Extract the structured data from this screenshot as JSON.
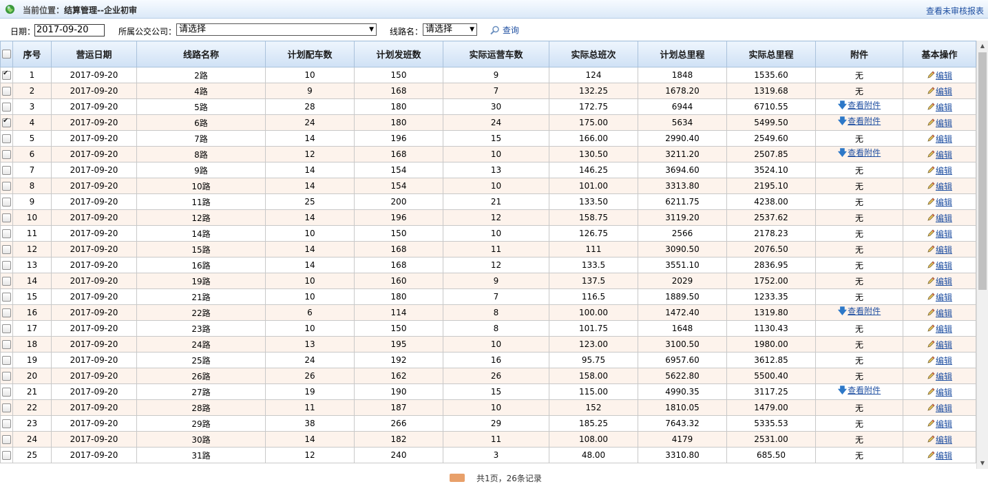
{
  "header": {
    "location_label": "当前位置：",
    "location_path": "结算管理--企业初审",
    "report_link": "查看未审核报表"
  },
  "filters": {
    "date_label": "日期：",
    "date_value": "2017-09-20",
    "company_label": "所属公交公司：",
    "company_value": "请选择",
    "route_label": "线路名：",
    "route_value": "请选择",
    "search_label": "查询"
  },
  "table": {
    "columns": [
      "序号",
      "营运日期",
      "线路名称",
      "计划配车数",
      "计划发班数",
      "实际运营车数",
      "实际总班次",
      "计划总里程",
      "实际总里程",
      "附件",
      "基本操作"
    ],
    "attachment_none": "无",
    "attachment_view": "查看附件",
    "edit_label": "编辑",
    "rows": [
      {
        "no": "1",
        "date": "2017-09-20",
        "route": "2路",
        "plan_cars": "10",
        "plan_shifts": "150",
        "actual_cars": "9",
        "actual_shifts": "124",
        "plan_km": "1848",
        "actual_km": "1535.60",
        "attach": false,
        "checked": true
      },
      {
        "no": "2",
        "date": "2017-09-20",
        "route": "4路",
        "plan_cars": "9",
        "plan_shifts": "168",
        "actual_cars": "7",
        "actual_shifts": "132.25",
        "plan_km": "1678.20",
        "actual_km": "1319.68",
        "attach": false,
        "checked": false
      },
      {
        "no": "3",
        "date": "2017-09-20",
        "route": "5路",
        "plan_cars": "28",
        "plan_shifts": "180",
        "actual_cars": "30",
        "actual_shifts": "172.75",
        "plan_km": "6944",
        "actual_km": "6710.55",
        "attach": true,
        "checked": false
      },
      {
        "no": "4",
        "date": "2017-09-20",
        "route": "6路",
        "plan_cars": "24",
        "plan_shifts": "180",
        "actual_cars": "24",
        "actual_shifts": "175.00",
        "plan_km": "5634",
        "actual_km": "5499.50",
        "attach": true,
        "checked": true
      },
      {
        "no": "5",
        "date": "2017-09-20",
        "route": "7路",
        "plan_cars": "14",
        "plan_shifts": "196",
        "actual_cars": "15",
        "actual_shifts": "166.00",
        "plan_km": "2990.40",
        "actual_km": "2549.60",
        "attach": false,
        "checked": false
      },
      {
        "no": "6",
        "date": "2017-09-20",
        "route": "8路",
        "plan_cars": "12",
        "plan_shifts": "168",
        "actual_cars": "10",
        "actual_shifts": "130.50",
        "plan_km": "3211.20",
        "actual_km": "2507.85",
        "attach": true,
        "checked": false
      },
      {
        "no": "7",
        "date": "2017-09-20",
        "route": "9路",
        "plan_cars": "14",
        "plan_shifts": "154",
        "actual_cars": "13",
        "actual_shifts": "146.25",
        "plan_km": "3694.60",
        "actual_km": "3524.10",
        "attach": false,
        "checked": false
      },
      {
        "no": "8",
        "date": "2017-09-20",
        "route": "10路",
        "plan_cars": "14",
        "plan_shifts": "154",
        "actual_cars": "10",
        "actual_shifts": "101.00",
        "plan_km": "3313.80",
        "actual_km": "2195.10",
        "attach": false,
        "checked": false
      },
      {
        "no": "9",
        "date": "2017-09-20",
        "route": "11路",
        "plan_cars": "25",
        "plan_shifts": "200",
        "actual_cars": "21",
        "actual_shifts": "133.50",
        "plan_km": "6211.75",
        "actual_km": "4238.00",
        "attach": false,
        "checked": false
      },
      {
        "no": "10",
        "date": "2017-09-20",
        "route": "12路",
        "plan_cars": "14",
        "plan_shifts": "196",
        "actual_cars": "12",
        "actual_shifts": "158.75",
        "plan_km": "3119.20",
        "actual_km": "2537.62",
        "attach": false,
        "checked": false
      },
      {
        "no": "11",
        "date": "2017-09-20",
        "route": "14路",
        "plan_cars": "10",
        "plan_shifts": "150",
        "actual_cars": "10",
        "actual_shifts": "126.75",
        "plan_km": "2566",
        "actual_km": "2178.23",
        "attach": false,
        "checked": false
      },
      {
        "no": "12",
        "date": "2017-09-20",
        "route": "15路",
        "plan_cars": "14",
        "plan_shifts": "168",
        "actual_cars": "11",
        "actual_shifts": "111",
        "plan_km": "3090.50",
        "actual_km": "2076.50",
        "attach": false,
        "checked": false
      },
      {
        "no": "13",
        "date": "2017-09-20",
        "route": "16路",
        "plan_cars": "14",
        "plan_shifts": "168",
        "actual_cars": "12",
        "actual_shifts": "133.5",
        "plan_km": "3551.10",
        "actual_km": "2836.95",
        "attach": false,
        "checked": false
      },
      {
        "no": "14",
        "date": "2017-09-20",
        "route": "19路",
        "plan_cars": "10",
        "plan_shifts": "160",
        "actual_cars": "9",
        "actual_shifts": "137.5",
        "plan_km": "2029",
        "actual_km": "1752.00",
        "attach": false,
        "checked": false
      },
      {
        "no": "15",
        "date": "2017-09-20",
        "route": "21路",
        "plan_cars": "10",
        "plan_shifts": "180",
        "actual_cars": "7",
        "actual_shifts": "116.5",
        "plan_km": "1889.50",
        "actual_km": "1233.35",
        "attach": false,
        "checked": false
      },
      {
        "no": "16",
        "date": "2017-09-20",
        "route": "22路",
        "plan_cars": "6",
        "plan_shifts": "114",
        "actual_cars": "8",
        "actual_shifts": "100.00",
        "plan_km": "1472.40",
        "actual_km": "1319.80",
        "attach": true,
        "checked": false
      },
      {
        "no": "17",
        "date": "2017-09-20",
        "route": "23路",
        "plan_cars": "10",
        "plan_shifts": "150",
        "actual_cars": "8",
        "actual_shifts": "101.75",
        "plan_km": "1648",
        "actual_km": "1130.43",
        "attach": false,
        "checked": false
      },
      {
        "no": "18",
        "date": "2017-09-20",
        "route": "24路",
        "plan_cars": "13",
        "plan_shifts": "195",
        "actual_cars": "10",
        "actual_shifts": "123.00",
        "plan_km": "3100.50",
        "actual_km": "1980.00",
        "attach": false,
        "checked": false
      },
      {
        "no": "19",
        "date": "2017-09-20",
        "route": "25路",
        "plan_cars": "24",
        "plan_shifts": "192",
        "actual_cars": "16",
        "actual_shifts": "95.75",
        "plan_km": "6957.60",
        "actual_km": "3612.85",
        "attach": false,
        "checked": false
      },
      {
        "no": "20",
        "date": "2017-09-20",
        "route": "26路",
        "plan_cars": "26",
        "plan_shifts": "162",
        "actual_cars": "26",
        "actual_shifts": "158.00",
        "plan_km": "5622.80",
        "actual_km": "5500.40",
        "attach": false,
        "checked": false
      },
      {
        "no": "21",
        "date": "2017-09-20",
        "route": "27路",
        "plan_cars": "19",
        "plan_shifts": "190",
        "actual_cars": "15",
        "actual_shifts": "115.00",
        "plan_km": "4990.35",
        "actual_km": "3117.25",
        "attach": true,
        "checked": false
      },
      {
        "no": "22",
        "date": "2017-09-20",
        "route": "28路",
        "plan_cars": "11",
        "plan_shifts": "187",
        "actual_cars": "10",
        "actual_shifts": "152",
        "plan_km": "1810.05",
        "actual_km": "1479.00",
        "attach": false,
        "checked": false
      },
      {
        "no": "23",
        "date": "2017-09-20",
        "route": "29路",
        "plan_cars": "38",
        "plan_shifts": "266",
        "actual_cars": "29",
        "actual_shifts": "185.25",
        "plan_km": "7643.32",
        "actual_km": "5335.53",
        "attach": false,
        "checked": false
      },
      {
        "no": "24",
        "date": "2017-09-20",
        "route": "30路",
        "plan_cars": "14",
        "plan_shifts": "182",
        "actual_cars": "11",
        "actual_shifts": "108.00",
        "plan_km": "4179",
        "actual_km": "2531.00",
        "attach": false,
        "checked": false
      },
      {
        "no": "25",
        "date": "2017-09-20",
        "route": "31路",
        "plan_cars": "12",
        "plan_shifts": "240",
        "actual_cars": "3",
        "actual_shifts": "48.00",
        "plan_km": "3310.80",
        "actual_km": "685.50",
        "attach": false,
        "checked": false
      }
    ]
  },
  "pager": {
    "summary": "共1页，26条记录"
  }
}
